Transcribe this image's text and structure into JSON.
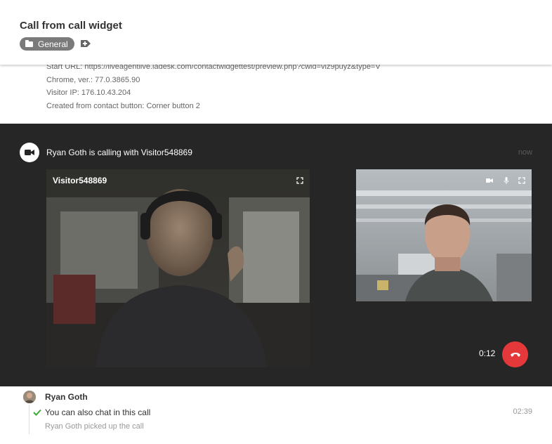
{
  "header": {
    "title": "Call from call widget",
    "tag_label": "General"
  },
  "info": {
    "start_url": "Start URL: https://liveagentlive.ladesk.com/contactwidgettest/preview.php?cwid=viz9puyz&type=V",
    "browser": "Chrome, ver.: 77.0.3865.90",
    "visitor_ip": "Visitor IP: 176.10.43.204",
    "created_from": "Created from contact button: Corner button 2"
  },
  "call": {
    "title": "Ryan Goth is calling with Visitor548869",
    "time": "now",
    "main_video_label": "Visitor548869",
    "timer": "0:12"
  },
  "chat": {
    "author": "Ryan Goth",
    "message": "You can also chat in this call",
    "message_time": "02:39",
    "system_note": "Ryan Goth picked up the call"
  },
  "colors": {
    "call_background": "#262626",
    "hangup": "#e4383a",
    "check": "#3aaa35",
    "tag": "#7a7a7a"
  },
  "icons": {
    "folder": "folder-icon",
    "add_tag": "add-tag-icon",
    "video": "video-camera-icon",
    "fullscreen": "fullscreen-icon",
    "mic": "microphone-icon",
    "hangup": "phone-hangup-icon",
    "check": "checkmark-icon"
  }
}
